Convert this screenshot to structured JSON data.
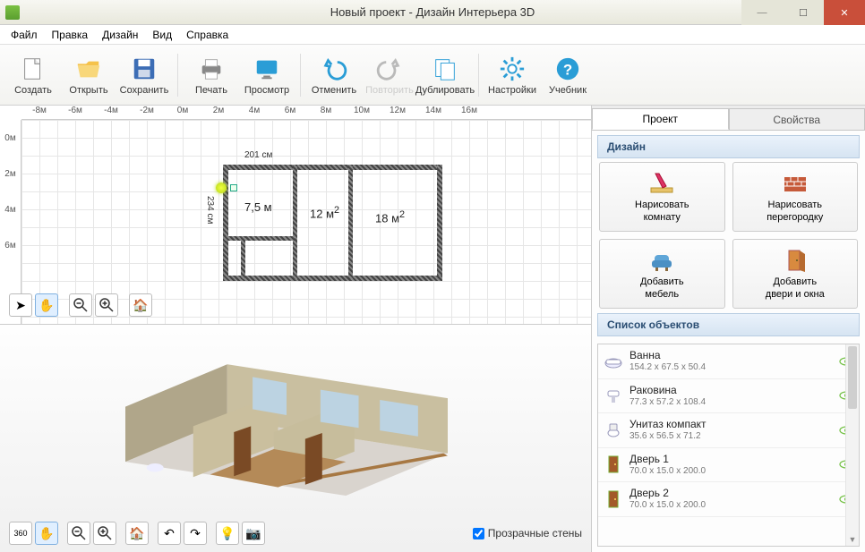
{
  "window": {
    "title": "Новый проект - Дизайн Интерьера 3D"
  },
  "menu": {
    "file": "Файл",
    "edit": "Правка",
    "design": "Дизайн",
    "view": "Вид",
    "help": "Справка"
  },
  "toolbar": {
    "create": "Создать",
    "open": "Открыть",
    "save": "Сохранить",
    "print": "Печать",
    "preview": "Просмотр",
    "undo": "Отменить",
    "redo": "Повторить",
    "duplicate": "Дублировать",
    "settings": "Настройки",
    "manual": "Учебник"
  },
  "ruler_h": [
    "-8м",
    "-6м",
    "-4м",
    "-2м",
    "0м",
    "2м",
    "4м",
    "6м",
    "8м",
    "10м",
    "12м",
    "14м",
    "16м"
  ],
  "ruler_v": [
    "0м",
    "2м",
    "4м",
    "6м"
  ],
  "plan": {
    "dim_w": "201 см",
    "dim_h": "234 см",
    "room1": "7,5 м",
    "room2": "12 м",
    "room2_sup": "2",
    "room3": "18 м",
    "room3_sup": "2"
  },
  "checkbox": {
    "transparent_walls": "Прозрачные стены"
  },
  "tabs": {
    "project": "Проект",
    "properties": "Свойства"
  },
  "sections": {
    "design": "Дизайн",
    "objects": "Список объектов"
  },
  "bigbtns": {
    "draw_room_l1": "Нарисовать",
    "draw_room_l2": "комнату",
    "draw_wall_l1": "Нарисовать",
    "draw_wall_l2": "перегородку",
    "add_furn_l1": "Добавить",
    "add_furn_l2": "мебель",
    "add_door_l1": "Добавить",
    "add_door_l2": "двери и окна"
  },
  "objects": [
    {
      "name": "Ванна",
      "dims": "154.2 x 67.5 x 50.4",
      "icon": "bathtub"
    },
    {
      "name": "Раковина",
      "dims": "77.3 x 57.2 x 108.4",
      "icon": "sink"
    },
    {
      "name": "Унитаз компакт",
      "dims": "35.6 x 56.5 x 71.2",
      "icon": "toilet"
    },
    {
      "name": "Дверь 1",
      "dims": "70.0 x 15.0 x 200.0",
      "icon": "door"
    },
    {
      "name": "Дверь 2",
      "dims": "70.0 x 15.0 x 200.0",
      "icon": "door"
    }
  ]
}
